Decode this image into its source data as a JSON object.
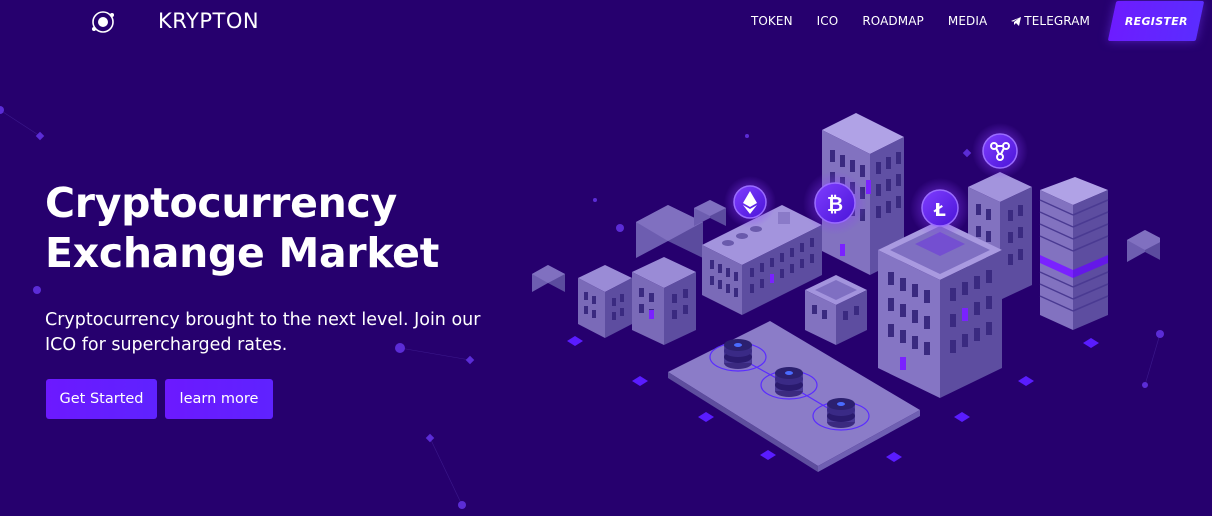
{
  "brand": {
    "name": "KRYPTON",
    "logo_icon": "atom-logo-icon"
  },
  "nav": {
    "items": [
      {
        "label": "TOKEN"
      },
      {
        "label": "ICO"
      },
      {
        "label": "ROADMAP"
      },
      {
        "label": "MEDIA"
      },
      {
        "label": "TELEGRAM",
        "icon": "telegram-icon"
      }
    ],
    "register_label": "REGISTER"
  },
  "hero": {
    "title_line1": "Cryptocurrency",
    "title_line2": "Exchange Market",
    "subtitle": "Cryptocurrency brought to the next level. Join our ICO for supercharged rates.",
    "primary_button": "Get Started",
    "secondary_button": "learn more"
  },
  "illustration": {
    "coin_icons": [
      "ethereum-coin-icon",
      "bitcoin-coin-icon",
      "litecoin-coin-icon",
      "ripple-coin-icon"
    ]
  },
  "colors": {
    "background": "#26006e",
    "accent": "#6c19ff",
    "building": "#8a78c7",
    "building_dark": "#5a4a9c",
    "glow": "#7a22ff"
  }
}
